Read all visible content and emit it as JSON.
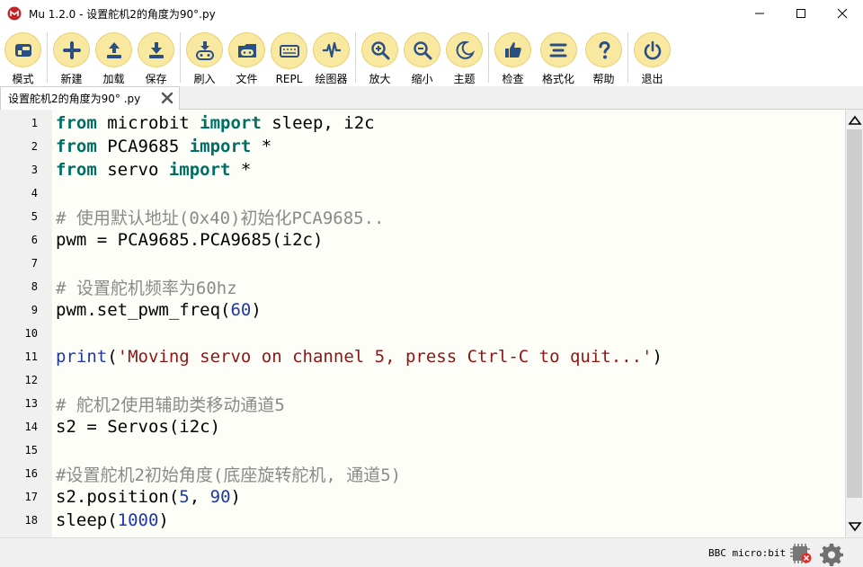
{
  "window": {
    "title": "Mu 1.2.0 - 设置舵机2的角度为90°.py",
    "controls": {
      "minimize": "minimize",
      "maximize": "maximize",
      "close": "close"
    }
  },
  "toolbar": {
    "buttons": [
      {
        "label": "模式",
        "icon": "mode-icon"
      },
      {
        "label": "新建",
        "icon": "plus-icon"
      },
      {
        "label": "加载",
        "icon": "upload-icon"
      },
      {
        "label": "保存",
        "icon": "download-icon"
      },
      {
        "label": "刷入",
        "icon": "flash-icon"
      },
      {
        "label": "文件",
        "icon": "files-icon"
      },
      {
        "label": "REPL",
        "icon": "keyboard-icon"
      },
      {
        "label": "绘图器",
        "icon": "plotter-icon"
      },
      {
        "label": "放大",
        "icon": "zoom-in-icon"
      },
      {
        "label": "缩小",
        "icon": "zoom-out-icon"
      },
      {
        "label": "主题",
        "icon": "moon-icon"
      },
      {
        "label": "检查",
        "icon": "thumbs-up-icon"
      },
      {
        "label": "格式化",
        "icon": "format-icon"
      },
      {
        "label": "帮助",
        "icon": "help-icon"
      },
      {
        "label": "退出",
        "icon": "power-icon"
      }
    ]
  },
  "tab": {
    "label": "设置舵机2的角度为90° .py"
  },
  "editor": {
    "line_numbers": [
      "1",
      "2",
      "3",
      "4",
      "5",
      "6",
      "7",
      "8",
      "9",
      "10",
      "11",
      "12",
      "13",
      "14",
      "15",
      "16",
      "17",
      "18"
    ],
    "lines": [
      [
        {
          "t": "kw",
          "v": "from"
        },
        {
          "t": "tx",
          "v": " microbit "
        },
        {
          "t": "kw",
          "v": "import"
        },
        {
          "t": "tx",
          "v": " sleep, i2c"
        }
      ],
      [
        {
          "t": "kw",
          "v": "from"
        },
        {
          "t": "tx",
          "v": " PCA9685 "
        },
        {
          "t": "kw",
          "v": "import"
        },
        {
          "t": "tx",
          "v": " *"
        }
      ],
      [
        {
          "t": "kw",
          "v": "from"
        },
        {
          "t": "tx",
          "v": " servo "
        },
        {
          "t": "kw",
          "v": "import"
        },
        {
          "t": "tx",
          "v": " *"
        }
      ],
      [],
      [
        {
          "t": "cm",
          "v": "# 使用默认地址(0x40)初始化PCA9685.."
        }
      ],
      [
        {
          "t": "tx",
          "v": "pwm = PCA9685.PCA9685(i2c)"
        }
      ],
      [],
      [
        {
          "t": "cm",
          "v": "# 设置舵机频率为60hz"
        }
      ],
      [
        {
          "t": "tx",
          "v": "pwm.set_pwm_freq("
        },
        {
          "t": "num",
          "v": "60"
        },
        {
          "t": "tx",
          "v": ")"
        }
      ],
      [],
      [
        {
          "t": "fn",
          "v": "print"
        },
        {
          "t": "tx",
          "v": "("
        },
        {
          "t": "str",
          "v": "'Moving servo on channel 5, press Ctrl-C to quit...'"
        },
        {
          "t": "tx",
          "v": ")"
        }
      ],
      [],
      [
        {
          "t": "cm",
          "v": "# 舵机2使用辅助类移动通道5"
        }
      ],
      [
        {
          "t": "tx",
          "v": "s2 = Servos(i2c)"
        }
      ],
      [],
      [
        {
          "t": "cm",
          "v": "#设置舵机2初始角度(底座旋转舵机, 通道5)"
        }
      ],
      [
        {
          "t": "tx",
          "v": "s2.position("
        },
        {
          "t": "num",
          "v": "5"
        },
        {
          "t": "tx",
          "v": ", "
        },
        {
          "t": "num",
          "v": "90"
        },
        {
          "t": "tx",
          "v": ")"
        }
      ],
      [
        {
          "t": "tx",
          "v": "sleep("
        },
        {
          "t": "num",
          "v": "1000"
        },
        {
          "t": "tx",
          "v": ")"
        }
      ]
    ]
  },
  "status": {
    "mode": "BBC micro:bit"
  },
  "colors": {
    "toolbar_button_bg": "#f9e8a0",
    "toolbar_icon": "#2a4f85",
    "keyword": "#006f63",
    "comment": "#8a8a8a",
    "number": "#1f38a6",
    "string": "#8f1515",
    "editor_bg": "#fefef8"
  }
}
